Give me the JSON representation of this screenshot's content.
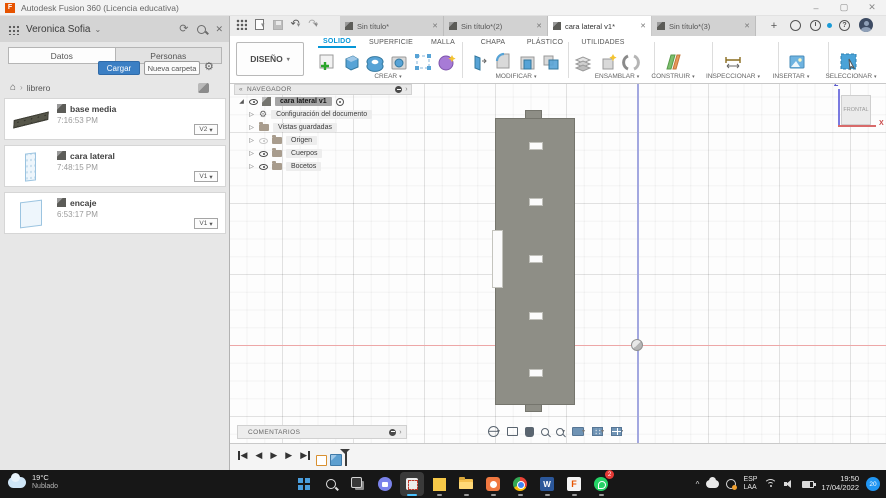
{
  "window": {
    "app_title": "Autodesk Fusion 360 (Licencia educativa)",
    "app_icon_letter": "F"
  },
  "glyphs": {
    "caret_down": "▾",
    "chevron_down": "⌄",
    "refresh": "⟳",
    "close": "✕",
    "gear": "⚙",
    "home": "⌂",
    "crumb_sep": "›",
    "tree_collapsed": "▷",
    "tree_expanded": "◢",
    "panel_left": "«",
    "panel_collapse": "›",
    "undo": "↶",
    "redo": "↷",
    "minimize": "–",
    "maximize": "▢",
    "play_back": "◀",
    "play_fwd": "▶",
    "plus": "+",
    "help": "?",
    "tray_caret": "^"
  },
  "left_panel": {
    "user_name": "Veronica Sofia",
    "tab_datos": "Datos",
    "tab_personas": "Personas",
    "upload": "Cargar",
    "new_folder": "Nueva carpeta",
    "breadcrumb": "librero",
    "files": [
      {
        "name": "base media",
        "time": "7:16:53 PM",
        "version": "V2"
      },
      {
        "name": "cara lateral",
        "time": "7:48:15 PM",
        "version": "V1"
      },
      {
        "name": "encaje",
        "time": "6:53:17 PM",
        "version": "V1"
      }
    ]
  },
  "tabs": {
    "items": [
      {
        "label": "Sin título*"
      },
      {
        "label": "Sin título*(2)"
      },
      {
        "label": "cara lateral v1*"
      },
      {
        "label": "Sin título*(3)"
      }
    ]
  },
  "ribbon": {
    "workspace": "DISEÑO",
    "tab_solido": "SOLIDO",
    "tab_superficie": "SUPERFICIE",
    "tab_malla": "MALLA",
    "tab_chapa": "CHAPA",
    "tab_plastico": "PLÁSTICO",
    "tab_utilidades": "UTILIDADES",
    "grp_crear": "CREAR",
    "grp_modificar": "MODIFICAR",
    "grp_ensamblar": "ENSAMBLAR",
    "grp_construir": "CONSTRUIR",
    "grp_inspeccionar": "INSPECCIONAR",
    "grp_insertar": "INSERTAR",
    "grp_seleccionar": "SELECCIONAR"
  },
  "navigator": {
    "title": "NAVEGADOR",
    "root": "cara lateral v1",
    "item_config": "Configuración del documento",
    "item_views": "Vistas guardadas",
    "item_origin": "Origen",
    "item_bodies": "Cuerpos",
    "item_sketches": "Bocetos"
  },
  "viewcube": {
    "face": "FRONTAL",
    "axis_z": "Z",
    "axis_x": "X"
  },
  "comments": {
    "title": "COMENTARIOS"
  },
  "taskbar": {
    "weather_temp": "19°C",
    "weather_desc": "Nublado",
    "lang_top": "ESP",
    "lang_bottom": "LAA",
    "time": "19:50",
    "date": "17/04/2022",
    "notif_count": "20",
    "whatsapp_badge": "2",
    "word_letter": "W",
    "fusion_letter": "F"
  },
  "colors": {
    "accent_blue": "#0696d7",
    "button_blue": "#3b7fc4",
    "body_gray": "#8e8e86",
    "axis_red": "#eda7a7",
    "axis_blue": "#a3a8e0",
    "taskbar_bg": "#171717"
  }
}
